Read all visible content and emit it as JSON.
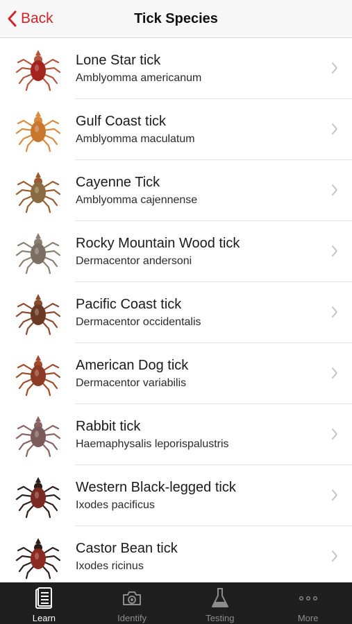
{
  "nav": {
    "back_label": "Back",
    "title": "Tick Species"
  },
  "accent_color": "#d0242b",
  "ticks": [
    {
      "name": "Lone Star tick",
      "scientific": "Amblyomma americanum",
      "body_color": "#a3231e",
      "leg_color": "#b4553a",
      "icon": "lone-star-tick-photo"
    },
    {
      "name": "Gulf Coast tick",
      "scientific": "Amblyomma maculatum",
      "body_color": "#c9772f",
      "leg_color": "#d98a3c",
      "icon": "gulf-coast-tick-photo"
    },
    {
      "name": "Cayenne Tick",
      "scientific": "Amblyomma cajennense",
      "body_color": "#8a6a43",
      "leg_color": "#9a5a2e",
      "icon": "cayenne-tick-photo"
    },
    {
      "name": "Rocky Mountain Wood tick",
      "scientific": "Dermacentor andersoni",
      "body_color": "#7a6f60",
      "leg_color": "#8a8070",
      "icon": "rocky-mountain-wood-tick-photo"
    },
    {
      "name": "Pacific Coast tick",
      "scientific": "Dermacentor occidentalis",
      "body_color": "#6b3a26",
      "leg_color": "#8a4a2e",
      "icon": "pacific-coast-tick-photo"
    },
    {
      "name": "American Dog tick",
      "scientific": "Dermacentor variabilis",
      "body_color": "#8b3a24",
      "leg_color": "#a24a2a",
      "icon": "american-dog-tick-photo"
    },
    {
      "name": "Rabbit tick",
      "scientific": "Haemaphysalis leporispalustris",
      "body_color": "#7a5a5a",
      "leg_color": "#8a6260",
      "icon": "rabbit-tick-photo"
    },
    {
      "name": "Western Black-legged tick",
      "scientific": "Ixodes pacificus",
      "body_color": "#7a2a22",
      "leg_color": "#2b1d1a",
      "icon": "western-black-legged-tick-photo"
    },
    {
      "name": "Castor Bean tick",
      "scientific": "Ixodes ricinus",
      "body_color": "#8a2a20",
      "leg_color": "#2b1d1a",
      "icon": "castor-bean-tick-photo"
    }
  ],
  "tabs": [
    {
      "label": "Learn",
      "icon": "book-icon",
      "active": true
    },
    {
      "label": "Identify",
      "icon": "camera-icon",
      "active": false
    },
    {
      "label": "Testing",
      "icon": "flask-icon",
      "active": false
    },
    {
      "label": "More",
      "icon": "more-icon",
      "active": false
    }
  ]
}
